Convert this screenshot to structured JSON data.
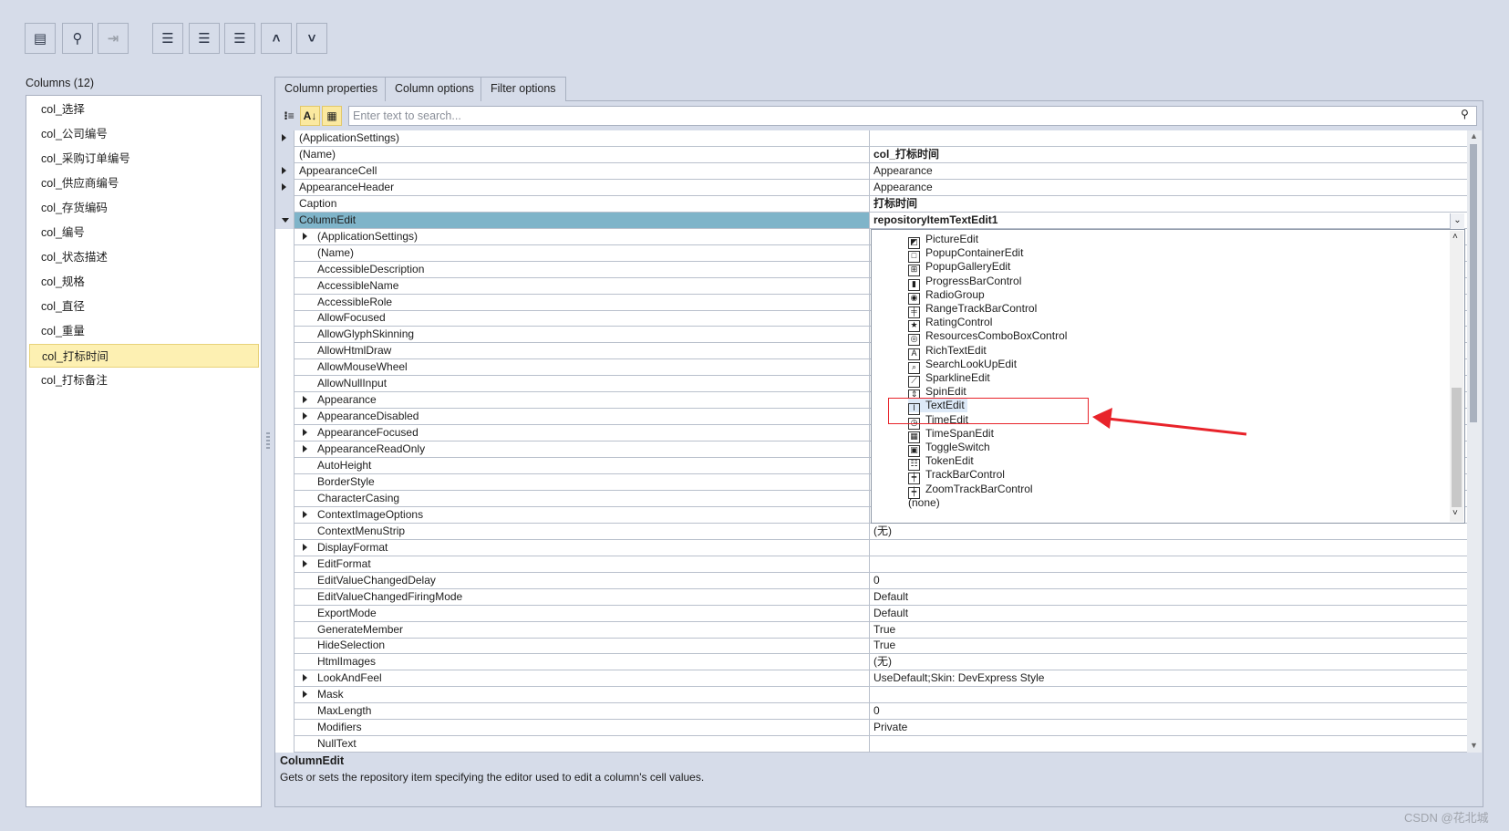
{
  "toolbar": [
    {
      "icon": "property-page-icon",
      "glyph": "▤",
      "disabled": false
    },
    {
      "icon": "search-icon",
      "glyph": "⚲",
      "disabled": false
    },
    {
      "icon": "exit-icon",
      "glyph": "⇥",
      "disabled": true
    },
    {
      "icon": "add-column-icon",
      "glyph": "☰",
      "disabled": false
    },
    {
      "icon": "insert-column-icon",
      "glyph": "☰",
      "disabled": false
    },
    {
      "icon": "remove-column-icon",
      "glyph": "☰",
      "disabled": false
    },
    {
      "icon": "move-up-icon",
      "glyph": "˄",
      "disabled": false
    },
    {
      "icon": "move-down-icon",
      "glyph": "˅",
      "disabled": false
    }
  ],
  "columns": {
    "label": "Columns (12)",
    "selected_index": 10,
    "items": [
      "col_选择",
      "col_公司编号",
      "col_采购订单编号",
      "col_供应商编号",
      "col_存货编码",
      "col_编号",
      "col_状态描述",
      "col_规格",
      "col_直径",
      "col_重量",
      "col_打标时间",
      "col_打标备注"
    ]
  },
  "tabs": [
    "Column properties",
    "Column options",
    "Filter options"
  ],
  "search": {
    "placeholder": "Enter text to search...",
    "value": ""
  },
  "grid_toolbar": [
    {
      "icon": "categorized-icon",
      "glyph": "⁝≡"
    },
    {
      "icon": "sort-alphabetical-icon",
      "glyph": "A↓"
    },
    {
      "icon": "property-pages-icon",
      "glyph": "▦"
    }
  ],
  "properties": [
    {
      "name": "(ApplicationSettings)",
      "level": 0,
      "expand": "closed",
      "value": ""
    },
    {
      "name": "(Name)",
      "level": 0,
      "value": "col_打标时间",
      "bold": true
    },
    {
      "name": "AppearanceCell",
      "level": 0,
      "expand": "closed",
      "value": "Appearance"
    },
    {
      "name": "AppearanceHeader",
      "level": 0,
      "expand": "closed",
      "value": "Appearance"
    },
    {
      "name": "Caption",
      "level": 0,
      "value": "打标时间",
      "bold": true
    },
    {
      "name": "ColumnEdit",
      "level": 0,
      "expand": "open",
      "value": "repositoryItemTextEdit1",
      "bold": true,
      "selected": true
    },
    {
      "name": "(ApplicationSettings)",
      "level": 1,
      "expand": "closed",
      "value": ""
    },
    {
      "name": "(Name)",
      "level": 1,
      "value": ""
    },
    {
      "name": "AccessibleDescription",
      "level": 1,
      "value": ""
    },
    {
      "name": "AccessibleName",
      "level": 1,
      "value": ""
    },
    {
      "name": "AccessibleRole",
      "level": 1,
      "value": ""
    },
    {
      "name": "AllowFocused",
      "level": 1,
      "value": ""
    },
    {
      "name": "AllowGlyphSkinning",
      "level": 1,
      "value": ""
    },
    {
      "name": "AllowHtmlDraw",
      "level": 1,
      "value": ""
    },
    {
      "name": "AllowMouseWheel",
      "level": 1,
      "value": ""
    },
    {
      "name": "AllowNullInput",
      "level": 1,
      "value": ""
    },
    {
      "name": "Appearance",
      "level": 1,
      "expand": "closed",
      "value": ""
    },
    {
      "name": "AppearanceDisabled",
      "level": 1,
      "expand": "closed",
      "value": ""
    },
    {
      "name": "AppearanceFocused",
      "level": 1,
      "expand": "closed",
      "value": ""
    },
    {
      "name": "AppearanceReadOnly",
      "level": 1,
      "expand": "closed",
      "value": ""
    },
    {
      "name": "AutoHeight",
      "level": 1,
      "value": ""
    },
    {
      "name": "BorderStyle",
      "level": 1,
      "value": ""
    },
    {
      "name": "CharacterCasing",
      "level": 1,
      "value": ""
    },
    {
      "name": "ContextImageOptions",
      "level": 1,
      "expand": "closed",
      "value": ""
    },
    {
      "name": "ContextMenuStrip",
      "level": 1,
      "value": "(无)"
    },
    {
      "name": "DisplayFormat",
      "level": 1,
      "expand": "closed",
      "value": ""
    },
    {
      "name": "EditFormat",
      "level": 1,
      "expand": "closed",
      "value": ""
    },
    {
      "name": "EditValueChangedDelay",
      "level": 1,
      "value": "0"
    },
    {
      "name": "EditValueChangedFiringMode",
      "level": 1,
      "value": "Default"
    },
    {
      "name": "ExportMode",
      "level": 1,
      "value": "Default"
    },
    {
      "name": "GenerateMember",
      "level": 1,
      "value": "True"
    },
    {
      "name": "HideSelection",
      "level": 1,
      "value": "True"
    },
    {
      "name": "HtmlImages",
      "level": 1,
      "value": "(无)"
    },
    {
      "name": "LookAndFeel",
      "level": 1,
      "expand": "closed",
      "value": "UseDefault;Skin: DevExpress Style"
    },
    {
      "name": "Mask",
      "level": 1,
      "expand": "closed",
      "value": ""
    },
    {
      "name": "MaxLength",
      "level": 1,
      "value": "0"
    },
    {
      "name": "Modifiers",
      "level": 1,
      "value": "Private"
    },
    {
      "name": "NullText",
      "level": 1,
      "value": ""
    }
  ],
  "dropdown": {
    "highlighted_index": 12,
    "items": [
      {
        "label": "PictureEdit",
        "icon": "picture-icon",
        "glyph": "◩"
      },
      {
        "label": "PopupContainerEdit",
        "icon": "popup-container-icon",
        "glyph": "□"
      },
      {
        "label": "PopupGalleryEdit",
        "icon": "gallery-icon",
        "glyph": "⊞"
      },
      {
        "label": "ProgressBarControl",
        "icon": "progress-bar-icon",
        "glyph": "▮"
      },
      {
        "label": "RadioGroup",
        "icon": "radio-icon",
        "glyph": "◉"
      },
      {
        "label": "RangeTrackBarControl",
        "icon": "range-track-icon",
        "glyph": "╪"
      },
      {
        "label": "RatingControl",
        "icon": "star-icon",
        "glyph": "★"
      },
      {
        "label": "ResourcesComboBoxControl",
        "icon": "resources-icon",
        "glyph": "◎"
      },
      {
        "label": "RichTextEdit",
        "icon": "rich-text-icon",
        "glyph": "A"
      },
      {
        "label": "SearchLookUpEdit",
        "icon": "search-lookup-icon",
        "glyph": "⌕"
      },
      {
        "label": "SparklineEdit",
        "icon": "sparkline-icon",
        "glyph": "⟋"
      },
      {
        "label": "SpinEdit",
        "icon": "spin-icon",
        "glyph": "⇕"
      },
      {
        "label": "TextEdit",
        "icon": "text-cursor-icon",
        "glyph": "I"
      },
      {
        "label": "TimeEdit",
        "icon": "clock-icon",
        "glyph": "◷"
      },
      {
        "label": "TimeSpanEdit",
        "icon": "timespan-icon",
        "glyph": "▦"
      },
      {
        "label": "ToggleSwitch",
        "icon": "toggle-icon",
        "glyph": "▣"
      },
      {
        "label": "TokenEdit",
        "icon": "token-icon",
        "glyph": "☷"
      },
      {
        "label": "TrackBarControl",
        "icon": "trackbar-icon",
        "glyph": "┿"
      },
      {
        "label": "ZoomTrackBarControl",
        "icon": "zoom-trackbar-icon",
        "glyph": "┿"
      },
      {
        "label": "(none)",
        "icon": "",
        "glyph": ""
      }
    ]
  },
  "description": {
    "title": "ColumnEdit",
    "text": "Gets or sets the repository item specifying the editor used to edit a column's cell values."
  },
  "annotation_color": "#e8232a",
  "watermark": "CSDN @花北城"
}
